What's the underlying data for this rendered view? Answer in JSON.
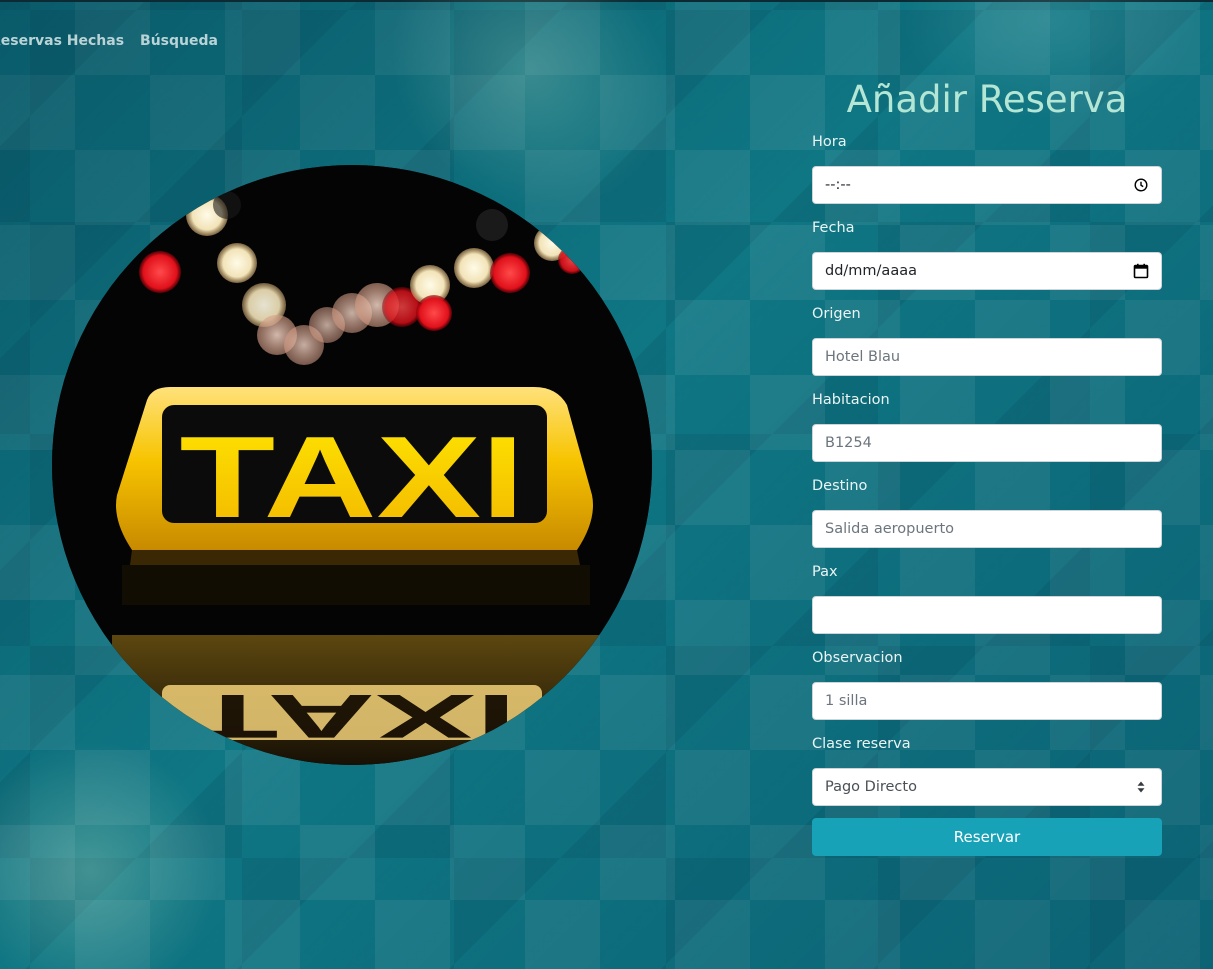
{
  "nav": {
    "items": [
      {
        "label": "Reservas Hechas"
      },
      {
        "label": "Búsqueda"
      }
    ]
  },
  "hero_image": {
    "sign_text": "TAXI",
    "reflection_text": "TAXI"
  },
  "form": {
    "title": "Añadir Reserva",
    "fields": {
      "hora": {
        "label": "Hora",
        "value": "--:--",
        "icon": "clock-icon"
      },
      "fecha": {
        "label": "Fecha",
        "value": "dd/mm/aaaa",
        "icon": "calendar-icon"
      },
      "origen": {
        "label": "Origen",
        "placeholder": "Hotel Blau"
      },
      "habitacion": {
        "label": "Habitacion",
        "placeholder": "B1254"
      },
      "destino": {
        "label": "Destino",
        "placeholder": "Salida aeropuerto"
      },
      "pax": {
        "label": "Pax",
        "value": ""
      },
      "observacion": {
        "label": "Observacion",
        "placeholder": "1 silla"
      },
      "clase": {
        "label": "Clase reserva",
        "selected": "Pago Directo",
        "icon": "select-arrows-icon"
      }
    },
    "submit_label": "Reservar"
  },
  "colors": {
    "background": "#0f7683",
    "title": "#b4e6d5",
    "button": "#17a2b8",
    "sign_yellow": "#f7c400"
  }
}
